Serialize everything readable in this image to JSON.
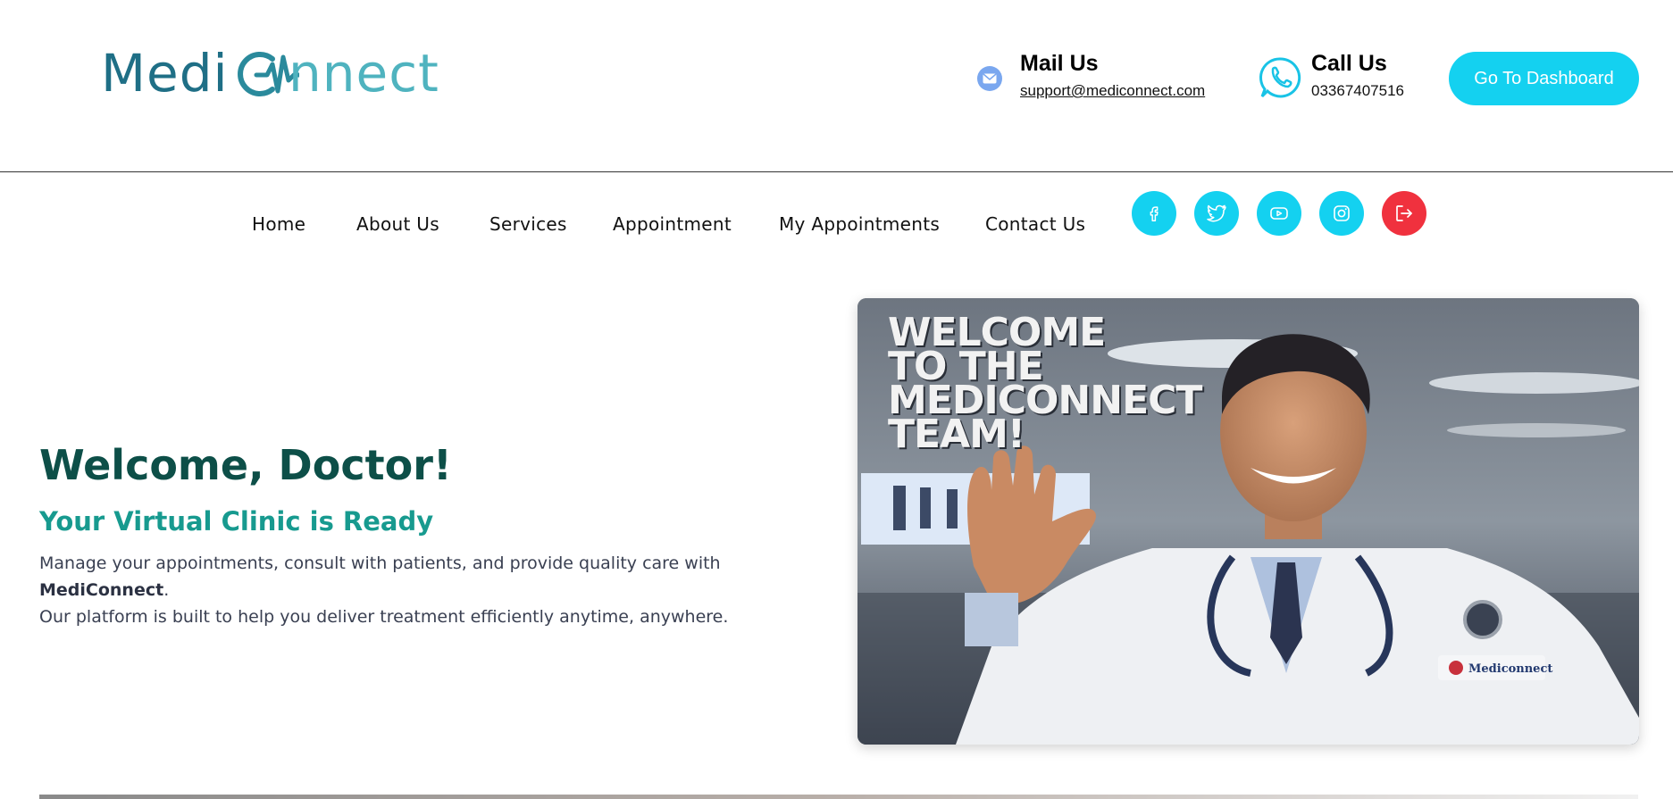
{
  "brand": {
    "logo_part1": "Medi",
    "logo_part2": "nnect",
    "logo_alt": "MediConnect"
  },
  "contact": {
    "mail_title": "Mail Us",
    "mail_value": "support@mediconnect.com",
    "call_title": "Call Us",
    "call_value": "03367407516"
  },
  "header": {
    "dashboard_button": "Go To Dashboard"
  },
  "nav": {
    "items": [
      {
        "label": "Home"
      },
      {
        "label": "About Us"
      },
      {
        "label": "Services"
      },
      {
        "label": "Appointment"
      },
      {
        "label": "My Appointments"
      },
      {
        "label": "Contact Us"
      }
    ],
    "social": [
      "facebook-icon",
      "twitter-icon",
      "youtube-icon",
      "instagram-icon",
      "logout-icon"
    ]
  },
  "hero": {
    "title": "Welcome, Doctor!",
    "subtitle": "Your Virtual Clinic is Ready",
    "desc_part1": "Manage your appointments, consult with patients, and provide quality care with ",
    "desc_brand": "MediConnect",
    "desc_part2": ".",
    "desc_line2": "Our platform is built to help you deliver treatment efficiently anytime, anywhere.",
    "image_text": [
      "WELCOME",
      "TO THE",
      "MEDICONNECT",
      "TEAM!"
    ],
    "coat_badge": "Mediconnect"
  },
  "colors": {
    "accent": "#14d1f0",
    "logout": "#f0313e",
    "title": "#0d4f48",
    "subtitle": "#179a8f",
    "logo_dark": "#1f6f86",
    "logo_light": "#4fb3bf"
  }
}
